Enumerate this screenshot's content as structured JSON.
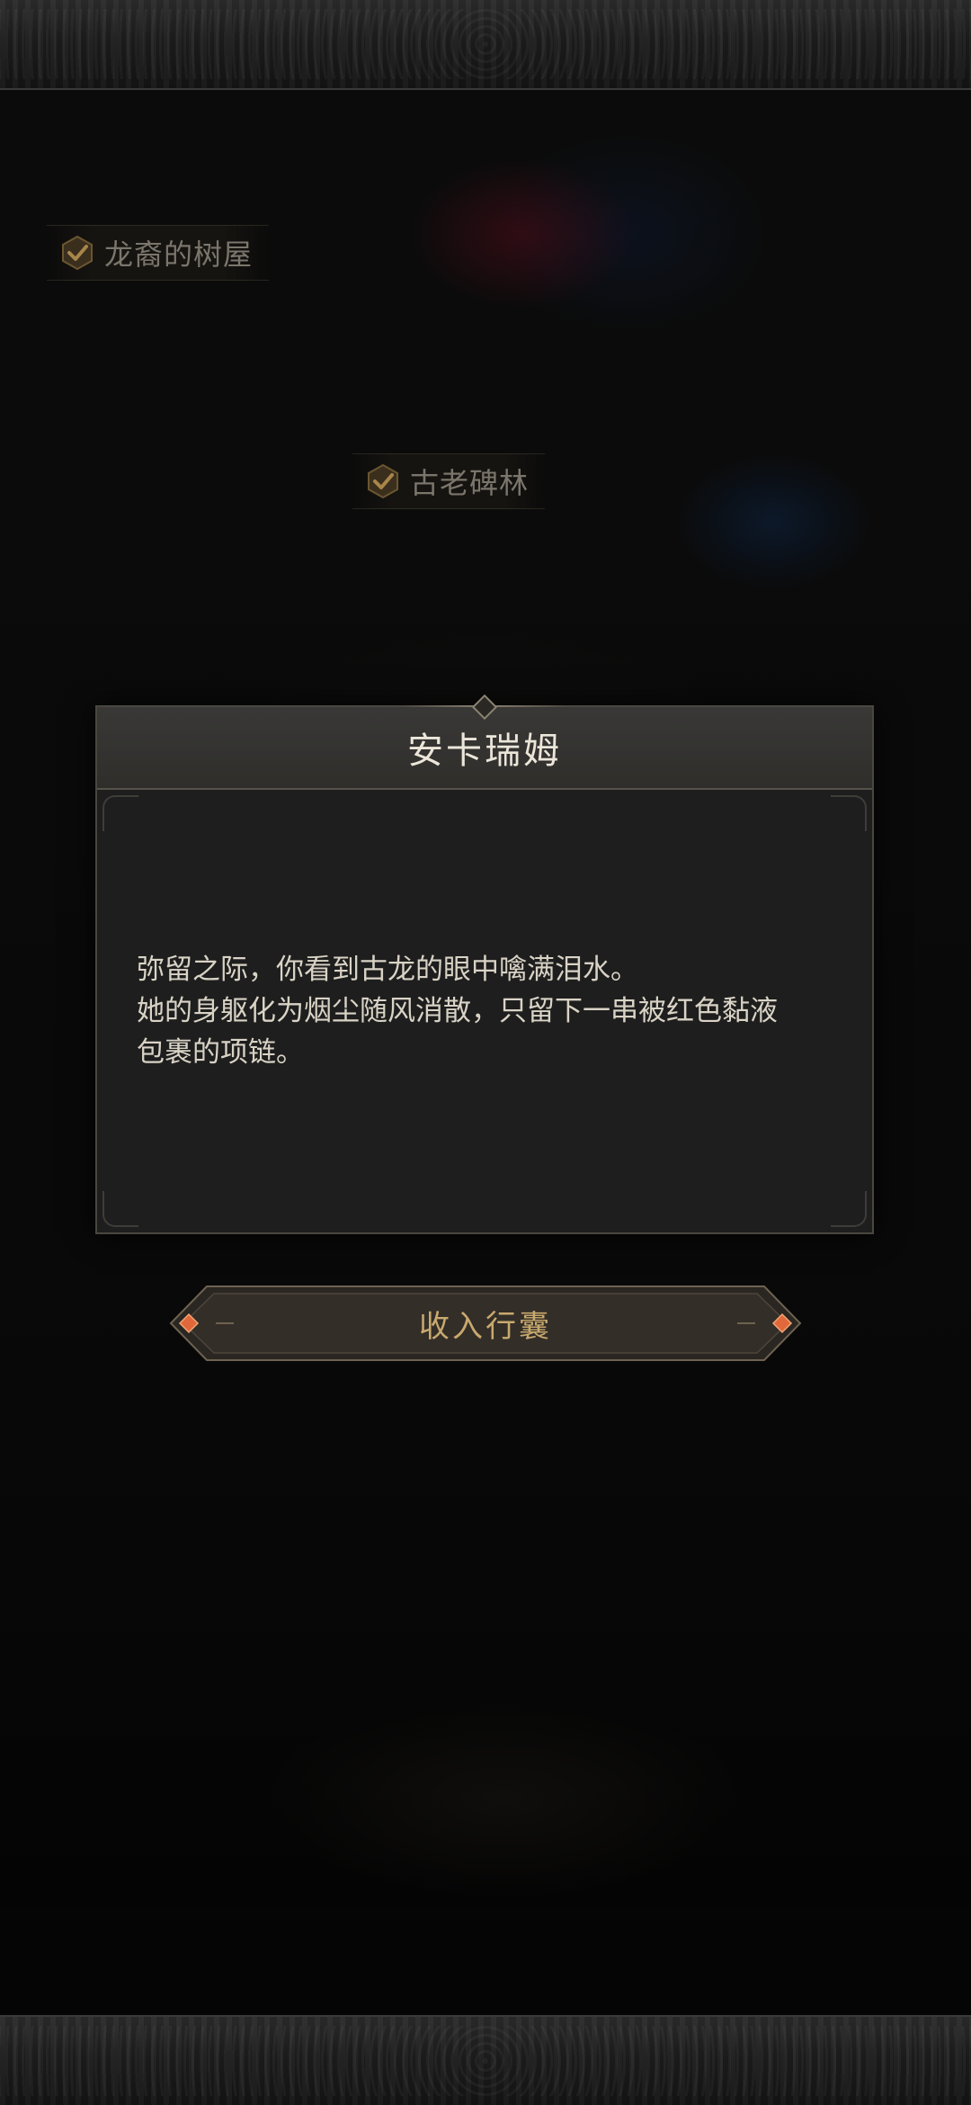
{
  "map_markers": [
    {
      "label": "龙裔的树屋",
      "completed": true
    },
    {
      "label": "古老碑林",
      "completed": true
    }
  ],
  "dialog": {
    "title": "安卡瑞姆",
    "lines": [
      "弥留之际，你看到古龙的眼中噙满泪水。",
      "她的身躯化为烟尘随风消散，只留下一串被红色黏液",
      "包裹的项链。"
    ]
  },
  "confirm_button": {
    "label": "收入行囊"
  },
  "colors": {
    "accent_gold": "#c8a96e",
    "gem_orange": "#e0683a",
    "panel_bg": "#1e1e1e",
    "panel_header": "#393836"
  },
  "icons": {
    "marker_check": "checkmark-icon",
    "button_gem": "diamond-gem-icon"
  }
}
